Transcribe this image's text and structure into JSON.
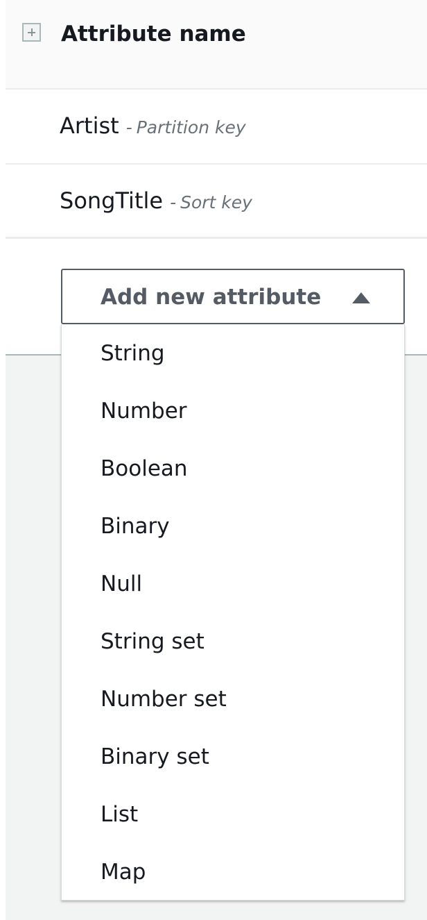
{
  "header": {
    "title": "Attribute name",
    "expand_icon": "plus-square-icon"
  },
  "attributes": [
    {
      "name": "Artist",
      "separator": "-",
      "key_type": "Partition key"
    },
    {
      "name": "SongTitle",
      "separator": "-",
      "key_type": "Sort key"
    }
  ],
  "add_button": {
    "label": "Add new attribute",
    "icon": "caret-up-icon"
  },
  "dropdown": {
    "options": [
      "String",
      "Number",
      "Boolean",
      "Binary",
      "Null",
      "String set",
      "Number set",
      "Binary set",
      "List",
      "Map"
    ]
  },
  "colors": {
    "text": "#16191f",
    "secondary_text": "#687078",
    "button_border": "#545b64",
    "divider": "#eaeded",
    "lower_background": "#f2f3f3"
  }
}
